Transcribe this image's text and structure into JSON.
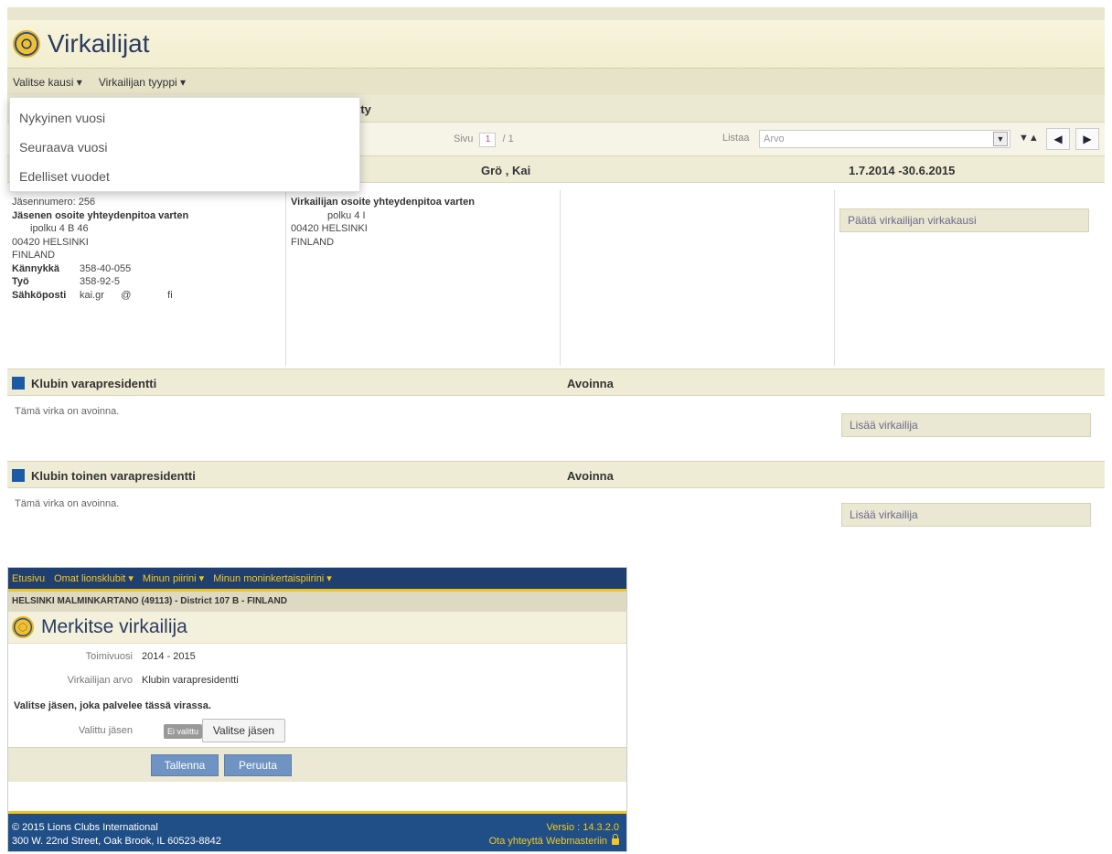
{
  "top": {
    "title": "Virkailijat",
    "menu": {
      "season": "Valitse kausi ▾",
      "officer_type": "Virkailijan tyyppi ▾"
    },
    "dropdown": [
      "Nykyinen vuosi",
      "Seuraava vuosi",
      "Edelliset vuodet"
    ],
    "list_header_fragment": "tty",
    "pager": {
      "page_label": "Sivu",
      "page_current": "1",
      "page_total": "/ 1",
      "sort_label": "Listaa",
      "sort_value": "Arvo",
      "sort_icon": "▼▲",
      "prev": "◀",
      "next": "▶"
    },
    "member": {
      "name": "Grö      , Kai",
      "period": "1.7.2014 -30.6.2015",
      "number": "Jäsennumero: 256",
      "member_addr_title": "Jäsenen osoite yhteydenpitoa varten",
      "member_addr": [
        "ipolku 4 B 46",
        "00420 HELSINKI",
        "FINLAND"
      ],
      "phones": [
        {
          "k": "Kännykkä",
          "v": "358-40-055"
        },
        {
          "k": "Työ",
          "v": "358-92-5"
        },
        {
          "k": "Sähköposti",
          "v": "kai.gr      @             fi"
        }
      ],
      "officer_addr_title": "Virkailijan osoite yhteydenpitoa varten",
      "officer_addr": [
        "polku 4 I",
        "00420 HELSINKI",
        "FINLAND"
      ],
      "end_term_button": "Päätä virkailijan virkakausi"
    },
    "positions": [
      {
        "title": "Klubin varapresidentti",
        "status": "Avoinna",
        "note": "Tämä virka on avoinna.",
        "add_button": "Lisää virkailija"
      },
      {
        "title": "Klubin toinen varapresidentti",
        "status": "Avoinna",
        "note": "Tämä virka on avoinna.",
        "add_button": "Lisää virkailija"
      }
    ]
  },
  "bottom": {
    "nav": [
      "Etusivu",
      "Omat lionsklubit ▾",
      "Minun piirini ▾",
      "Minun moninkertaispiirini ▾"
    ],
    "club": "HELSINKI MALMINKARTANO (49113) - District 107 B - FINLAND",
    "title": "Merkitse virkailija",
    "fields": {
      "year_label": "Toimivuosi",
      "year_value": "2014 - 2015",
      "rank_label": "Virkailijan arvo",
      "rank_value": "Klubin varapresidentti"
    },
    "instruction": "Valitse jäsen, joka palvelee tässä virassa.",
    "member_label": "Valittu jäsen",
    "member_badge": "Ei valittu",
    "pick_button": "Valitse jäsen",
    "save_button": "Tallenna",
    "cancel_button": "Peruuta",
    "footer": {
      "copyright": "© 2015 Lions Clubs International",
      "address": "300 W. 22nd Street, Oak Brook, IL 60523-8842",
      "version": "Versio : 14.3.2.0",
      "contact": "Ota yhteyttä Webmasteriin"
    }
  }
}
